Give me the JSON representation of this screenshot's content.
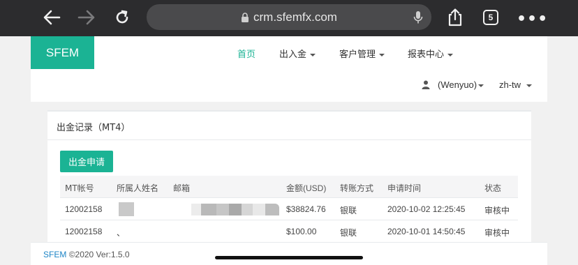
{
  "browser": {
    "url": "crm.sfemfx.com",
    "tab_count": "5",
    "more": "•••"
  },
  "brand": "SFEM",
  "nav": {
    "items": [
      {
        "label": "首页",
        "active": true
      },
      {
        "label": "出入金",
        "dropdown": true
      },
      {
        "label": "客户管理",
        "dropdown": true
      },
      {
        "label": "报表中心",
        "dropdown": true
      }
    ],
    "user": "(Wenyuo)",
    "language": "zh-tw"
  },
  "panel": {
    "title": "出金记录（MT4）",
    "apply_button": "出金申请"
  },
  "table": {
    "columns": [
      "MT帐号",
      "所属人姓名",
      "邮箱",
      "金额(USD)",
      "转账方式",
      "申请时间",
      "状态"
    ],
    "rows": [
      {
        "account": "12002158",
        "owner": "",
        "email": "",
        "amount": "$38824.76",
        "method": "银联",
        "time": "2020-10-02 12:25:45",
        "status": "审核中"
      },
      {
        "account": "12002158",
        "owner": "、",
        "email": "",
        "amount": "$100.00",
        "method": "银联",
        "time": "2020-10-01 14:50:45",
        "status": "审核中"
      }
    ]
  },
  "footer": {
    "brand": "SFEM",
    "text": "©2020 Ver:1.5.0"
  },
  "colors": {
    "accent": "#1bb394",
    "chrome": "#2c2c2e",
    "link": "#1c84c6"
  }
}
